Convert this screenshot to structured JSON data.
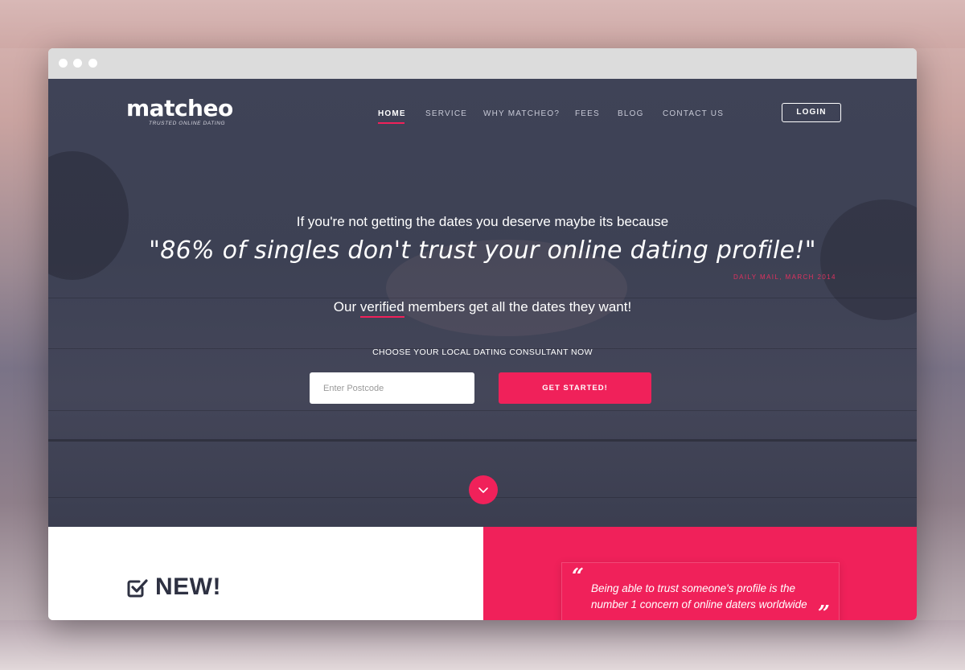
{
  "brand": {
    "name": "matcheo",
    "tagline": "TRUSTED ONLINE DATING"
  },
  "nav": {
    "items": [
      {
        "label": "HOME",
        "active": true
      },
      {
        "label": "SERVICE",
        "active": false
      },
      {
        "label": "WHY MATCHEO?",
        "active": false
      },
      {
        "label": "FEES",
        "active": false
      },
      {
        "label": "BLOG",
        "active": false
      },
      {
        "label": "CONTACT US",
        "active": false
      }
    ],
    "login_label": "LOGIN"
  },
  "hero": {
    "lead": "If you're not getting the dates you deserve maybe its because",
    "quote": "\"86% of singles don't trust your online dating profile!\"",
    "source": "DAILY MAIL, MARCH 2014",
    "members_before": "Our ",
    "members_highlight": "verified",
    "members_after": " members get all the dates they want!",
    "choose_label": "CHOOSE YOUR LOCAL DATING CONSULTANT NOW",
    "postcode_placeholder": "Enter Postcode",
    "cta_label": "GET STARTED!",
    "scroll_icon": "chevron-down-icon"
  },
  "feature": {
    "title": "NEW!",
    "icon": "checkbox-icon"
  },
  "testimonial": {
    "text": "Being able to trust someone's profile is the number 1 concern of online daters worldwide",
    "open_quote": "“",
    "close_quote": "”"
  },
  "colors": {
    "accent": "#f0215a",
    "hero_overlay": "#3f4357",
    "dark_text": "#2e3142"
  }
}
